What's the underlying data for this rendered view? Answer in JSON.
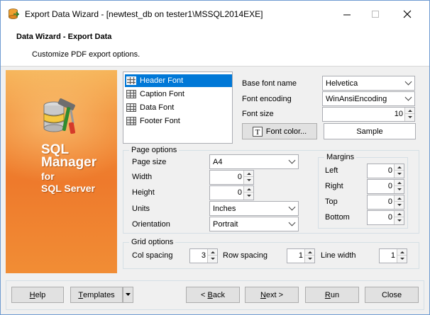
{
  "window": {
    "title": "Export Data Wizard - [newtest_db on tester1\\MSSQL2014EXE]",
    "minimize_label": "—",
    "maximize_label": "☐",
    "close_label": "✕"
  },
  "header": {
    "title": "Data Wizard - Export Data",
    "subtitle": "Customize PDF export options."
  },
  "banner": {
    "line1": "SQL",
    "line2": "Manager",
    "line3": "for",
    "line4": "SQL Server"
  },
  "font_list": {
    "items": [
      {
        "label": "Header Font",
        "selected": true
      },
      {
        "label": "Caption Font",
        "selected": false
      },
      {
        "label": "Data Font",
        "selected": false
      },
      {
        "label": "Footer Font",
        "selected": false
      }
    ]
  },
  "font_settings": {
    "base_font_label": "Base font name",
    "base_font_value": "Helvetica",
    "encoding_label": "Font encoding",
    "encoding_value": "WinAnsiEncoding",
    "size_label": "Font size",
    "size_value": "10",
    "font_color_button": "Font color...",
    "sample_label": "Sample"
  },
  "page_options": {
    "title": "Page options",
    "page_size_label": "Page size",
    "page_size_value": "A4",
    "width_label": "Width",
    "width_value": "0",
    "height_label": "Height",
    "height_value": "0",
    "units_label": "Units",
    "units_value": "Inches",
    "orientation_label": "Orientation",
    "orientation_value": "Portrait"
  },
  "margins": {
    "title": "Margins",
    "left_label": "Left",
    "left_value": "0",
    "right_label": "Right",
    "right_value": "0",
    "top_label": "Top",
    "top_value": "0",
    "bottom_label": "Bottom",
    "bottom_value": "0"
  },
  "grid_options": {
    "title": "Grid options",
    "col_spacing_label": "Col spacing",
    "col_spacing_value": "3",
    "row_spacing_label": "Row spacing",
    "row_spacing_value": "1",
    "line_width_label": "Line width",
    "line_width_value": "1"
  },
  "footer": {
    "help": {
      "u": "H",
      "rest": "elp"
    },
    "templates": {
      "u": "T",
      "rest": "emplates"
    },
    "back": {
      "pre": "< ",
      "u": "B",
      "rest": "ack"
    },
    "next": {
      "u": "N",
      "rest": "ext >"
    },
    "run": {
      "u": "R",
      "rest": "un"
    },
    "close_label": "Close"
  },
  "colors": {
    "accent": "#0078d7",
    "banner_orange": "#ee7a2c",
    "window_border": "#6f9bd1"
  }
}
